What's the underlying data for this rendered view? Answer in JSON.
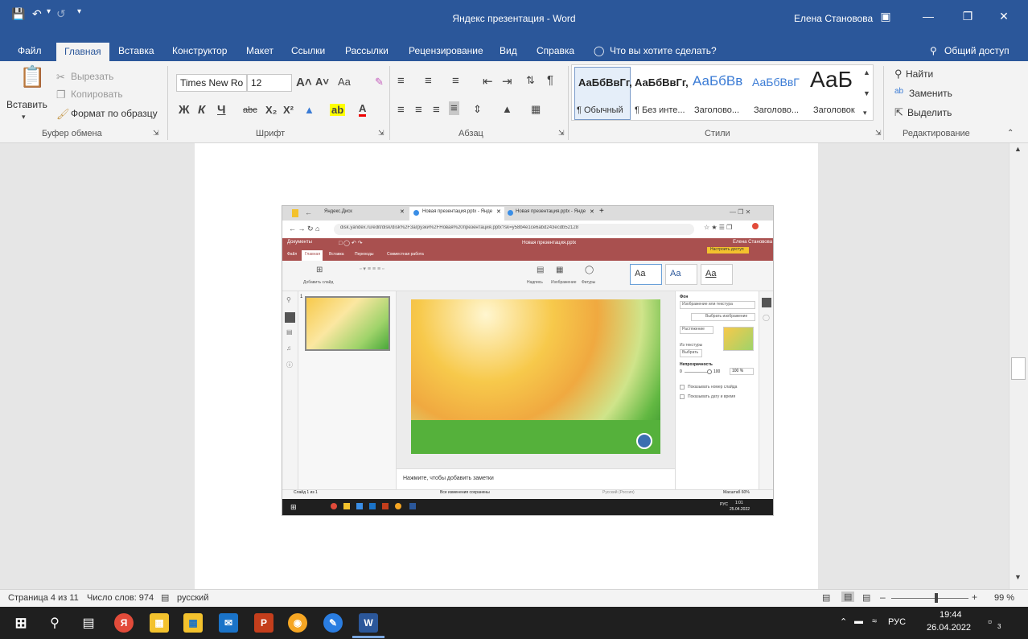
{
  "titlebar": {
    "title": "Яндекс презентация  -  Word",
    "user": "Елена Становова",
    "save_icon": "save-icon",
    "undo_icon": "undo-icon"
  },
  "tabs": [
    "Файл",
    "Главная",
    "Вставка",
    "Конструктор",
    "Макет",
    "Ссылки",
    "Рассылки",
    "Рецензирование",
    "Вид",
    "Справка"
  ],
  "tell_me": "Что вы хотите сделать?",
  "share": "Общий доступ",
  "ribbon": {
    "clipboard": {
      "paste": "Вставить",
      "cut": "Вырезать",
      "copy": "Копировать",
      "format_painter": "Формат по образцу",
      "label": "Буфер обмена"
    },
    "font": {
      "name": "Times New Ro",
      "size": "12",
      "label": "Шрифт",
      "bold": "Ж",
      "italic": "К",
      "underline": "Ч",
      "strike": "abc",
      "sub": "X₂",
      "sup": "X²",
      "grow": "A˄",
      "shrink": "A˅",
      "case": "Aa",
      "color": "A"
    },
    "paragraph": {
      "label": "Абзац"
    },
    "styles": {
      "label": "Стили",
      "items": [
        {
          "preview": "АаБбВвГг,",
          "name": "¶ Обычный"
        },
        {
          "preview": "АаБбВвГг,",
          "name": "¶ Без инте..."
        },
        {
          "preview": "АаБбВв",
          "name": "Заголово..."
        },
        {
          "preview": "АаБбВвГ",
          "name": "Заголово..."
        },
        {
          "preview": "АаБ",
          "name": "Заголовок"
        }
      ]
    },
    "editing": {
      "find": "Найти",
      "replace": "Заменить",
      "select": "Выделить",
      "label": "Редактирование"
    }
  },
  "embedded": {
    "tab1": "Яндекс.Диск",
    "tab2": "Новая презентация.pptx - Янде",
    "tab3": "Новая презентация.pptx - Янде",
    "url": "disk.yandex.ru/edit/disk/disk%2F3агрузки%2FНовая%20презентация.pptx?sk=y58b4e1ce6abd243ecdb52128",
    "docs": "Документы",
    "pres_title": "Новая презентация.pptx",
    "user": "Елена Становова",
    "access": "Настроить доступ",
    "menu": [
      "Файл",
      "Главная",
      "Вставка",
      "Переходы",
      "Совместная работа"
    ],
    "add_slide": "Добавить слайд",
    "label_caption": "Надпись",
    "label_images": "Изображение",
    "label_shapes": "Фигуры",
    "theme_labels": [
      "Aa",
      "Aa",
      "Aa"
    ],
    "panel": {
      "bg": "Фон",
      "fill": "Изображение или текстура",
      "choose": "Выбрать изображение",
      "stretch": "Растяжение",
      "from_texture": "Из текстуры",
      "choose_short": "Выбрать",
      "opacity": "Непрозрачность",
      "zero": "0",
      "hundred": "100",
      "pct": "100 %",
      "show_num": "Показывать номер слайда",
      "show_date": "Показывать дату и время"
    },
    "notes": "Нажмите, чтобы добавить заметки",
    "slide_counter": "Слайд 1 из 1",
    "saved": "Все изменения сохранены",
    "lang": "Русский (Россия)",
    "zoom": "Масштаб 60%",
    "tb_time": "1:01",
    "tb_date": "25.04.2022",
    "tb_lang": "РУС",
    "slide_num": "1"
  },
  "status": {
    "page": "Страница 4 из 11",
    "words": "Число слов: 974",
    "lang": "русский",
    "zoom": "99 %"
  },
  "taskbar": {
    "time": "19:44",
    "date": "26.04.2022",
    "lang": "РУС",
    "notif": "3"
  }
}
